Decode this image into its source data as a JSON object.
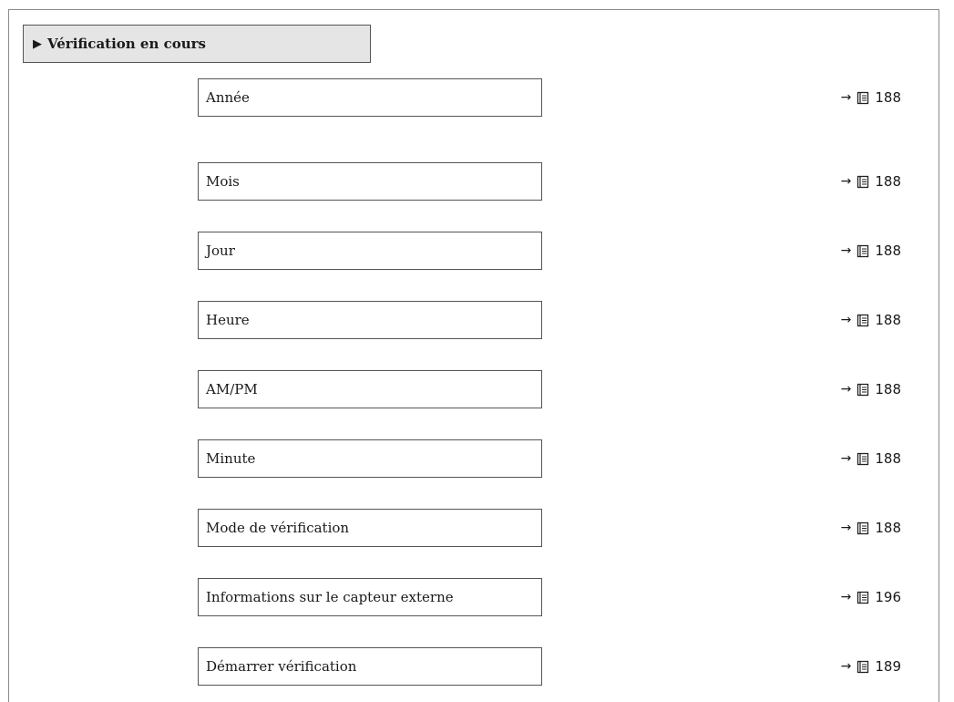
{
  "header": {
    "marker": "▶",
    "title": "Vérification en cours"
  },
  "rows": [
    {
      "label": "Année",
      "arrow": "→",
      "page": "188"
    },
    {
      "label": "Mois",
      "arrow": "→",
      "page": "188"
    },
    {
      "label": "Jour",
      "arrow": "→",
      "page": "188"
    },
    {
      "label": "Heure",
      "arrow": "→",
      "page": "188"
    },
    {
      "label": "AM/PM",
      "arrow": "→",
      "page": "188"
    },
    {
      "label": "Minute",
      "arrow": "→",
      "page": "188"
    },
    {
      "label": "Mode de vérification",
      "arrow": "→",
      "page": "188"
    },
    {
      "label": "Informations sur le capteur externe",
      "arrow": "→",
      "page": "196"
    },
    {
      "label": "Démarrer vérification",
      "arrow": "→",
      "page": "189"
    }
  ]
}
